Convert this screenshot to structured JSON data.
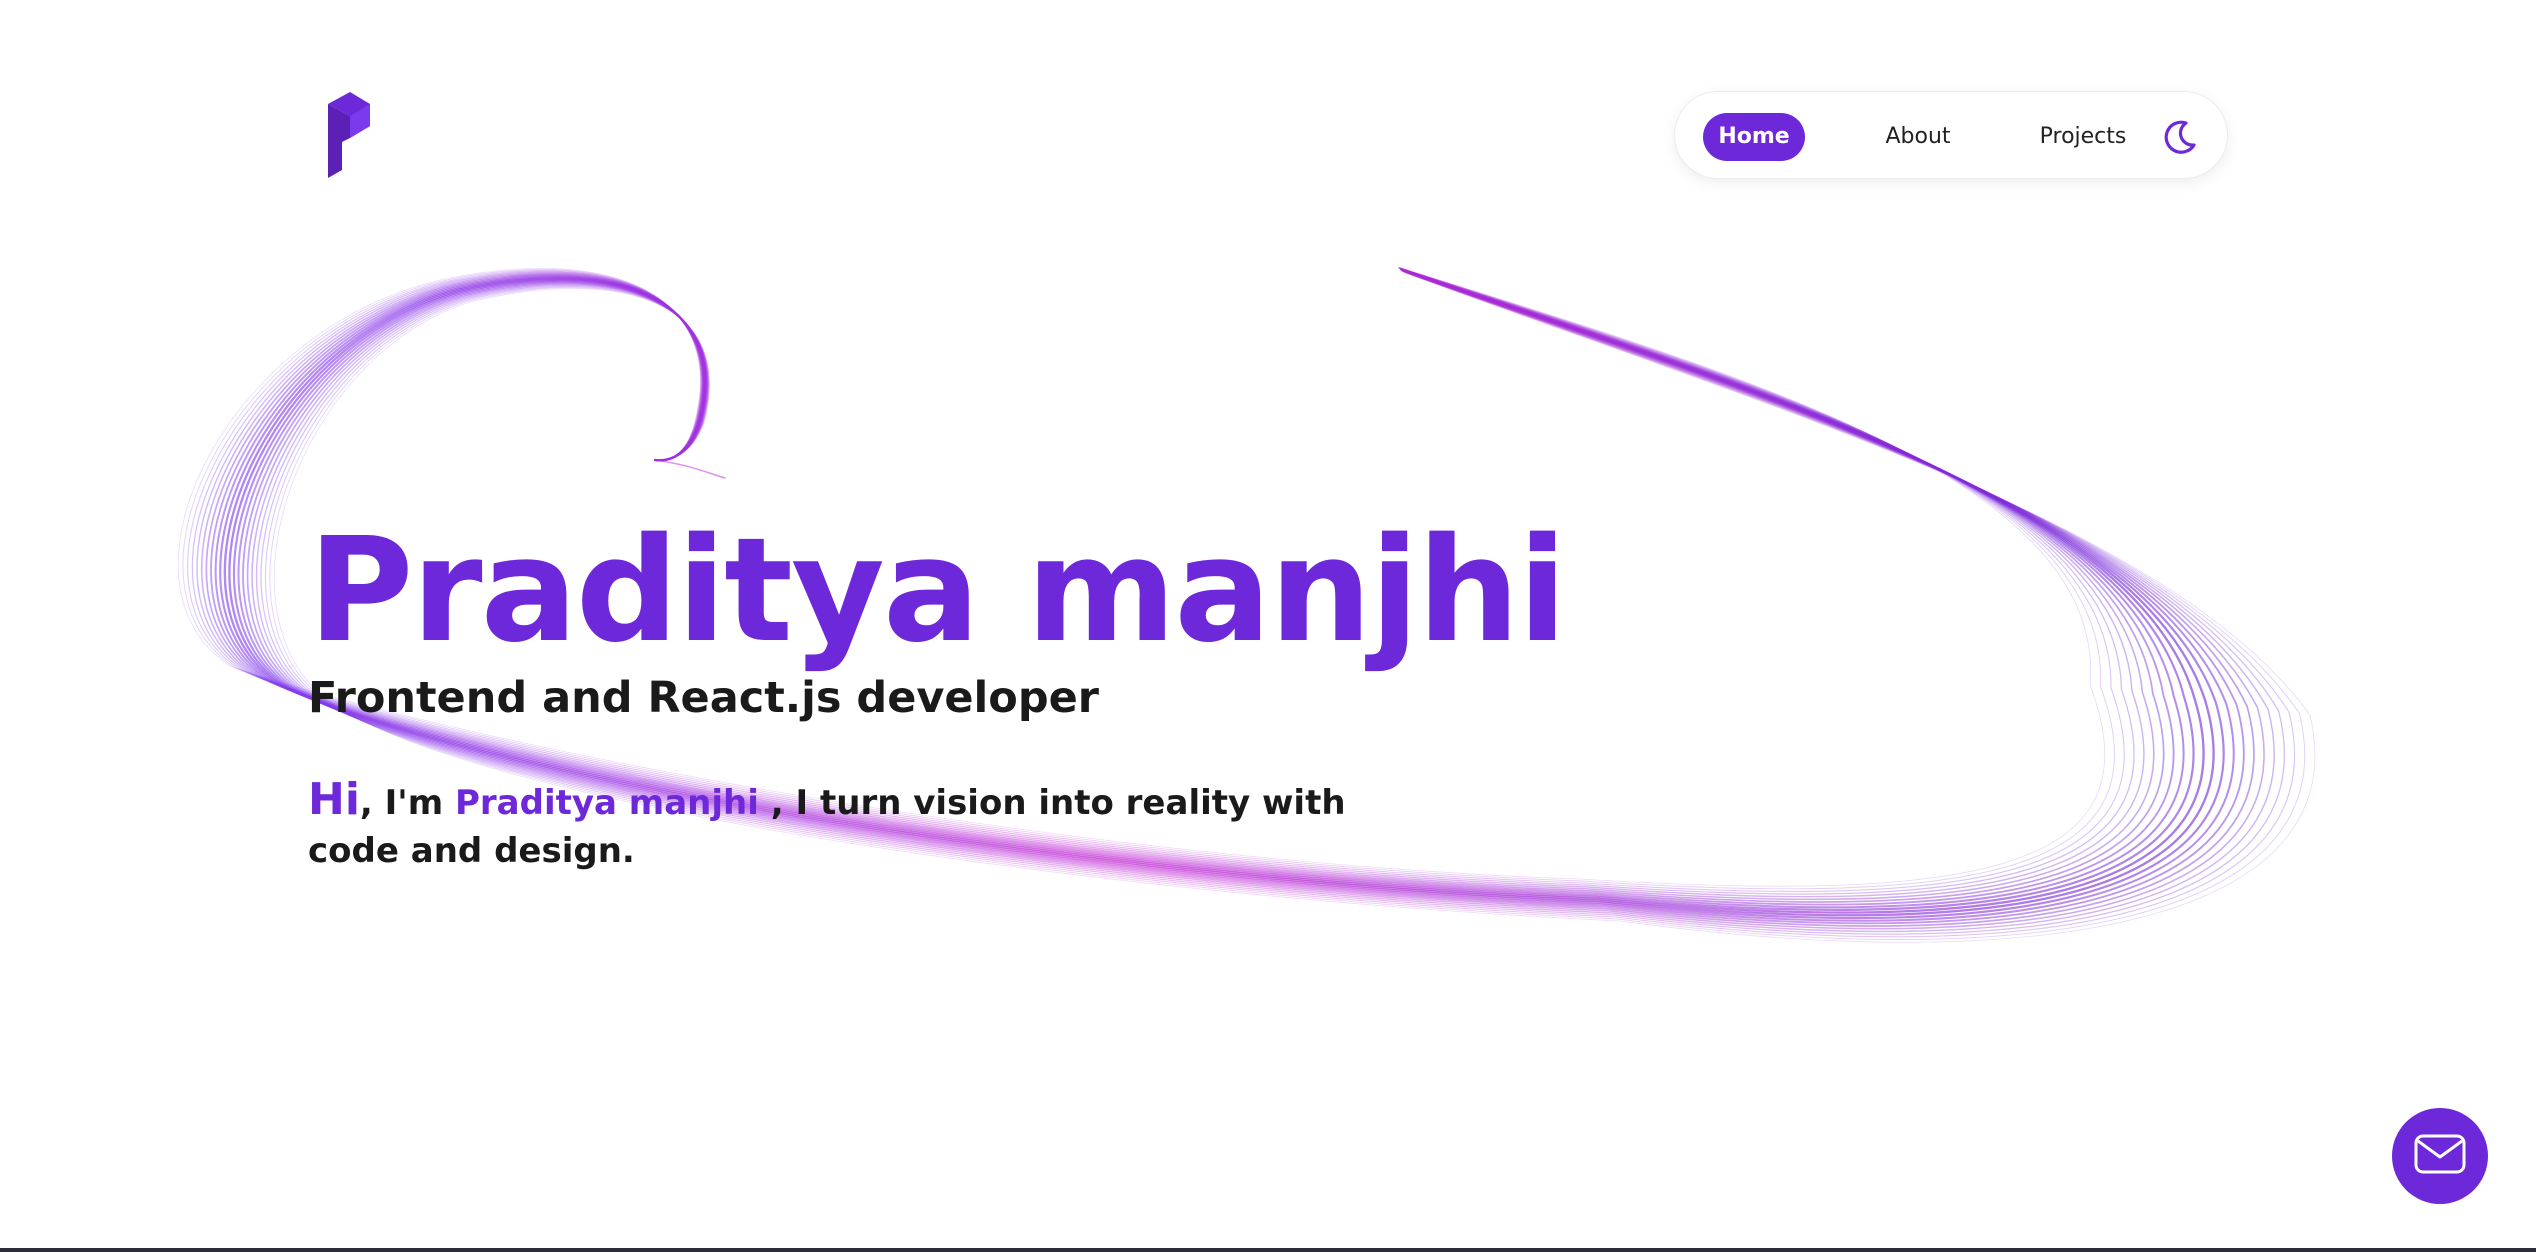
{
  "brand": {
    "logo_icon": "p-logo-icon",
    "accent_color": "#6d28d9",
    "swirl_highlight_color": "#e040fb"
  },
  "nav": {
    "items": [
      {
        "label": "Home",
        "active": true
      },
      {
        "label": "About",
        "active": false
      },
      {
        "label": "Projects",
        "active": false
      }
    ],
    "theme_toggle_icon": "moon-icon"
  },
  "hero": {
    "name": "Praditya manjhi",
    "role": "Frontend and React.js developer",
    "intro": {
      "greeting": "Hi",
      "im": ", I'm ",
      "name": "Praditya manjhi",
      "rest": " , I turn vision into reality with code and design."
    }
  },
  "contact": {
    "icon": "mail-icon"
  }
}
